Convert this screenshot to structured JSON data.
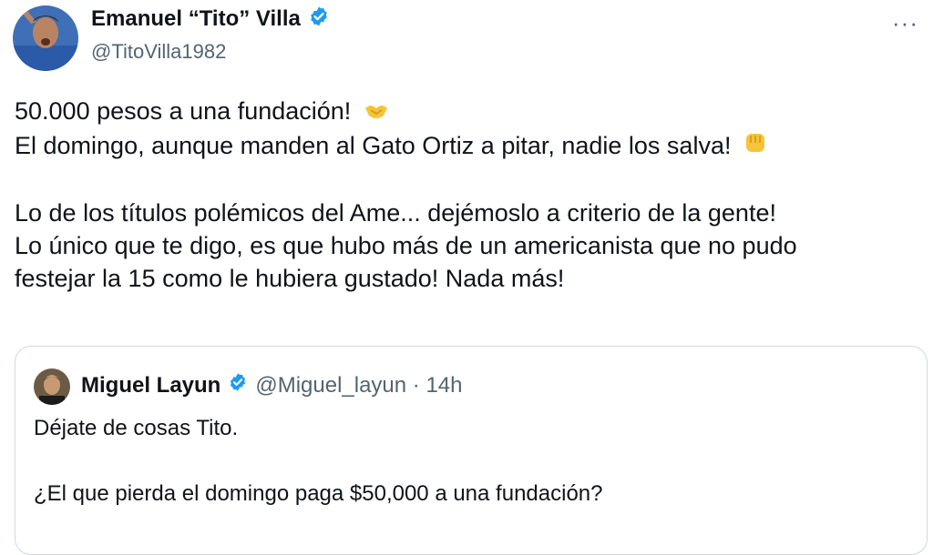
{
  "author": {
    "name": "Emanuel “Tito” Villa",
    "handle": "@TitoVilla1982",
    "verified_icon": "verified-badge-icon",
    "avatar_icon": "profile-avatar"
  },
  "menu": {
    "more_label": "···"
  },
  "tweet": {
    "line1": "50.000 pesos a una fundación!",
    "line2": "El domingo, aunque manden al Gato Ortiz a pitar, nadie los salva!",
    "line3": "Lo de los títulos polémicos del Ame... dejémoslo a criterio de la gente!",
    "line4": "Lo único que te digo, es que hubo más de un americanista que no pudo",
    "line5": "festejar la 15 como le hubiera gustado! Nada más!",
    "emoji1": "handshake-emoji",
    "emoji2": "fist-emoji"
  },
  "quoted": {
    "name": "Miguel Layun",
    "handle_time": "@Miguel_layun · 14h",
    "line1": "Déjate de cosas Tito.",
    "line2": "¿El que pierda el domingo paga $50,000 a una fundación?"
  },
  "colors": {
    "verified": "#1d9bf0",
    "secondary_text": "#536471",
    "border": "#cfd9de"
  }
}
